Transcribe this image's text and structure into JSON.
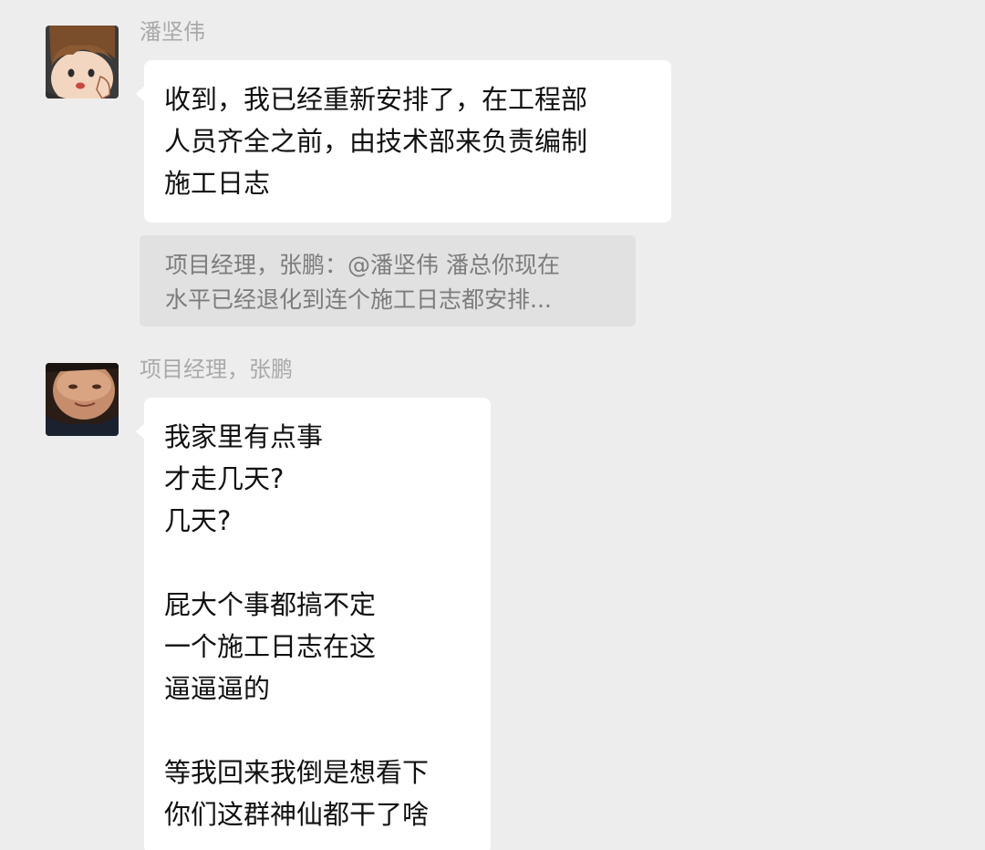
{
  "messages": [
    {
      "sender": "潘坚伟",
      "lines": [
        "收到，我已经重新安排了，在工程部",
        "人员齐全之前，由技术部来负责编制",
        "施工日志"
      ]
    },
    {
      "sender": "项目经理，张鹏",
      "lines": [
        "我家里有点事",
        "才走几天?",
        "几天?",
        "",
        "屁大个事都搞不定",
        "一个施工日志在这",
        "逼逼逼的",
        "",
        "等我回来我倒是想看下",
        "你们这群神仙都干了啥"
      ]
    }
  ],
  "quote": {
    "lines": [
      "项目经理，张鹏：@潘坚伟 潘总你现在",
      "水平已经退化到连个施工日志都安排..."
    ]
  },
  "colors": {
    "background": "#ededed",
    "bubble": "#ffffff",
    "quote_bg": "#e1e1e1",
    "sender_name": "#a9a9a9"
  },
  "icons": {
    "avatar_1": "cartoon-boy-avatar",
    "avatar_2": "photo-portrait-avatar"
  }
}
